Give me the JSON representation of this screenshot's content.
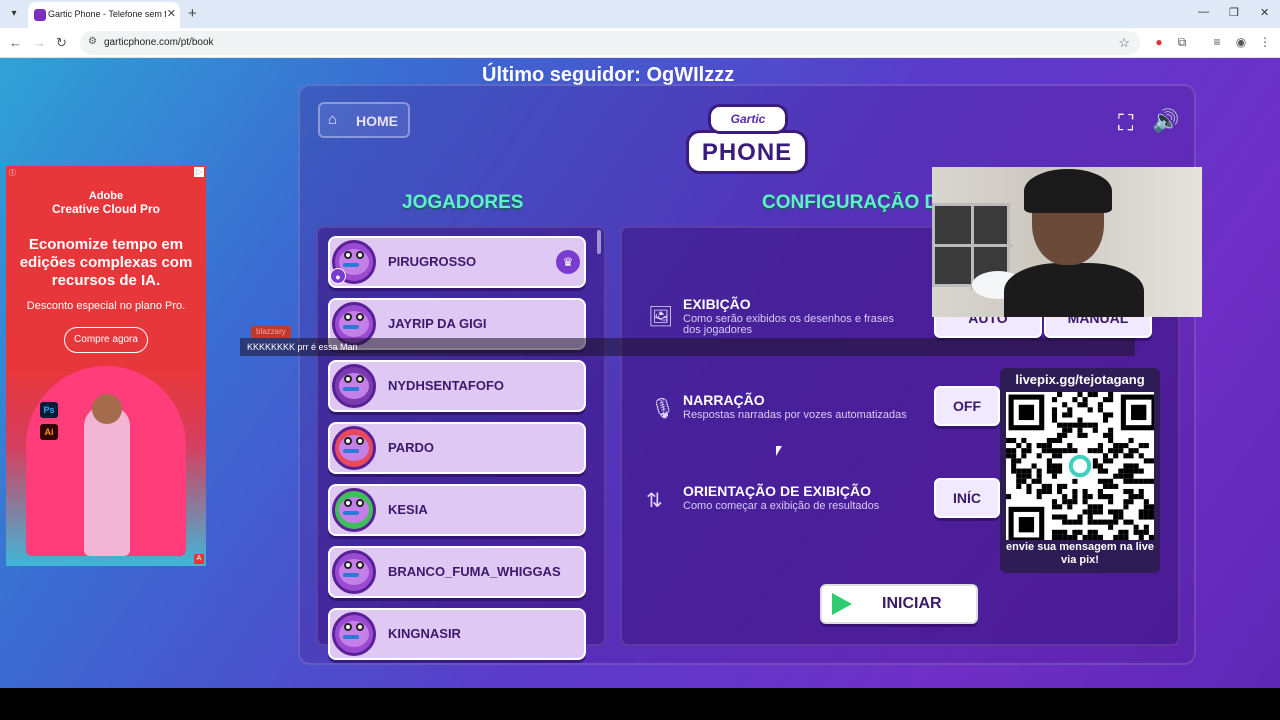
{
  "browser": {
    "tab_title": "Gartic Phone - Telefone sem fio",
    "url": "garticphone.com/pt/book",
    "new_tab": "+",
    "close": "✕",
    "minimize": "—",
    "restore": "❐",
    "window_close": "✕"
  },
  "stream": {
    "last_follower": "Último seguidor: OgWIlzzz"
  },
  "game": {
    "home_label": "HOME",
    "logo_top": "Gartic",
    "logo_bottom": "PHONE",
    "players_title": "JOGADORES",
    "settings_title": "CONFIGURAÇÃO DO",
    "players": [
      {
        "name": "PIRUGROSSO",
        "host": true
      },
      {
        "name": "JAYRIP DA GIGI"
      },
      {
        "name": "NYDHSENTAFOFO"
      },
      {
        "name": "PARDO"
      },
      {
        "name": "KESIA"
      },
      {
        "name": "BRANCO_FUMA_WHIGGAS"
      },
      {
        "name": "KINGNASIR"
      }
    ],
    "settings": {
      "exhibition": {
        "title": "EXIBIÇÃO",
        "desc": "Como serão exibidos os desenhos e frases dos jogadores",
        "opt_auto": "AUTO",
        "opt_manual": "MANUAL"
      },
      "narration": {
        "title": "NARRAÇÃO",
        "desc": "Respostas narradas por vozes automatizadas",
        "value": "OFF"
      },
      "orientation": {
        "title": "ORIENTAÇÃO DE EXIBIÇÃO",
        "desc": "Como começar a exibição de resultados",
        "value": "INÍC"
      }
    },
    "start_label": "INICIAR"
  },
  "chat": {
    "user": "blazzary",
    "message": "KKKKKKKK prr é essa Man"
  },
  "ad": {
    "brand": "Adobe",
    "product": "Creative Cloud Pro",
    "headline": "Economize tempo em edições complexas com recursos de IA.",
    "desc": "Desconto especial no plano Pro.",
    "cta": "Compre agora",
    "app_ps": "Ps",
    "app_ai": "Ai"
  },
  "qr": {
    "title": "livepix.gg/tejotagang",
    "caption": "envie sua mensagem na live via pix!"
  }
}
